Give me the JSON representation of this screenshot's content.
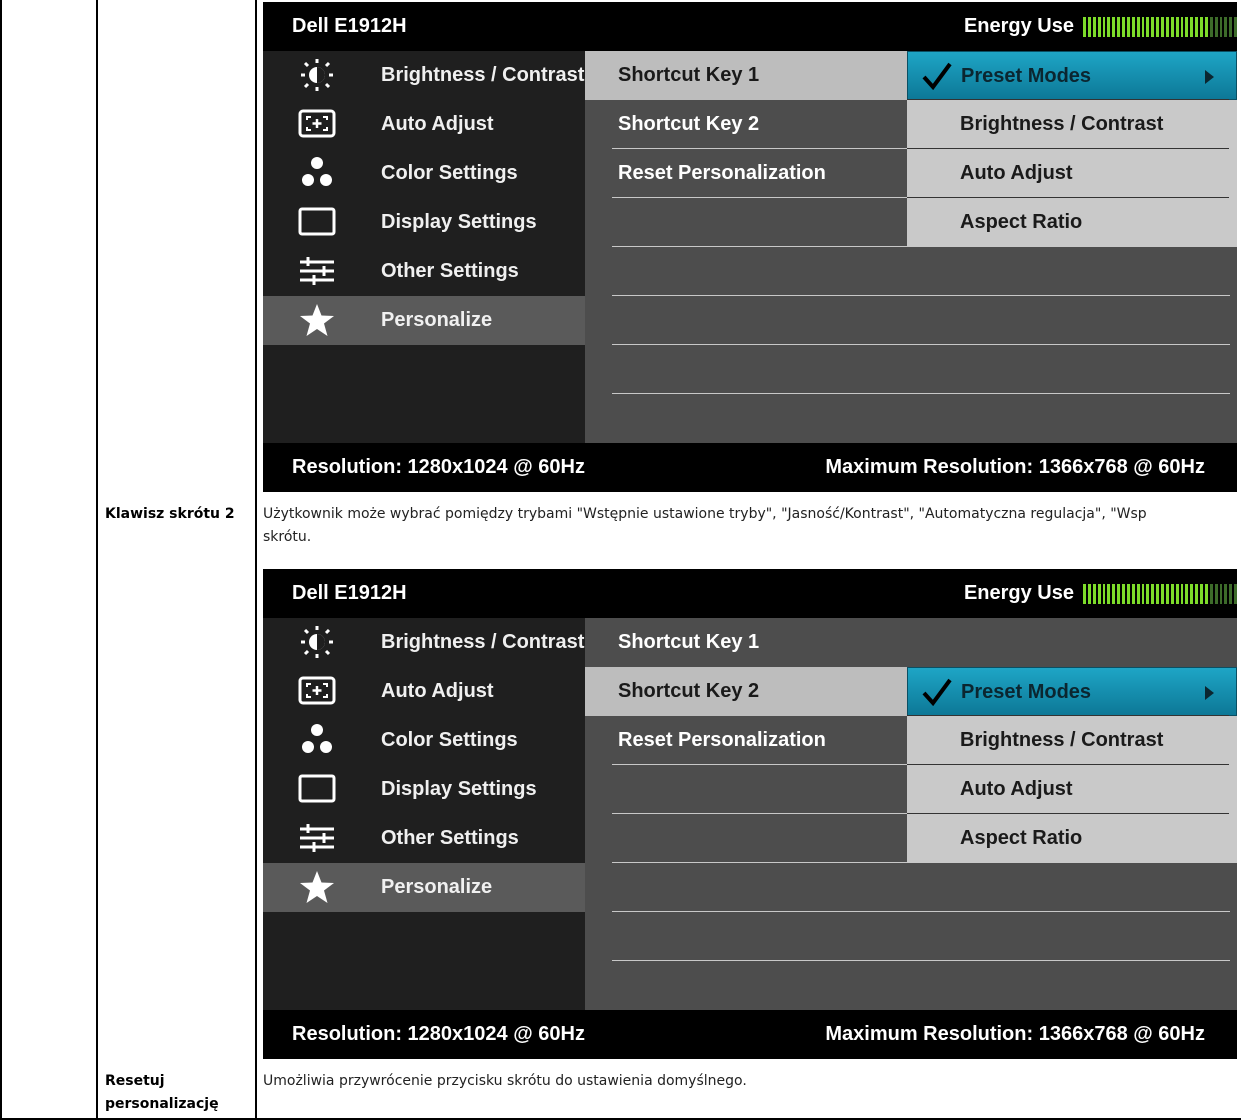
{
  "osd": {
    "model": "Dell E1912H",
    "energy_label": "Energy Use",
    "energy_level": 0.82,
    "resolution": "Resolution: 1280x1024 @ 60Hz",
    "max_resolution": "Maximum Resolution: 1366x768 @ 60Hz",
    "menu": [
      {
        "label": "Brightness / Contrast",
        "icon": "brightness-icon"
      },
      {
        "label": "Auto Adjust",
        "icon": "auto-adjust-icon"
      },
      {
        "label": "Color Settings",
        "icon": "color-settings-icon"
      },
      {
        "label": "Display Settings",
        "icon": "display-settings-icon"
      },
      {
        "label": "Other Settings",
        "icon": "other-settings-icon"
      },
      {
        "label": "Personalize",
        "icon": "star-icon"
      }
    ],
    "submenu": [
      "Shortcut Key 1",
      "Shortcut Key 2",
      "Reset Personalization"
    ],
    "options": [
      "Preset Modes",
      "Brightness / Contrast",
      "Auto Adjust",
      "Aspect Ratio"
    ],
    "colors": {
      "highlight": "#1ea5c6",
      "meter_on": "#7ddc2a",
      "meter_off": "#3d6b2a"
    }
  },
  "rows": {
    "shortcut2_label": "Klawisz skrótu 2",
    "shortcut2_desc": "Użytkownik może wybrać pomiędzy trybami \"Wstępnie ustawione tryby\", \"Jasność/Kontrast\", \"Automatyczna regulacja\", \"Wsp",
    "shortcut2_desc_2": "skrótu.",
    "reset_label_1": "Resetuj",
    "reset_label_2": "personalizację",
    "reset_desc": "Umożliwia przywrócenie przycisku skrótu do ustawienia domyślnego."
  }
}
